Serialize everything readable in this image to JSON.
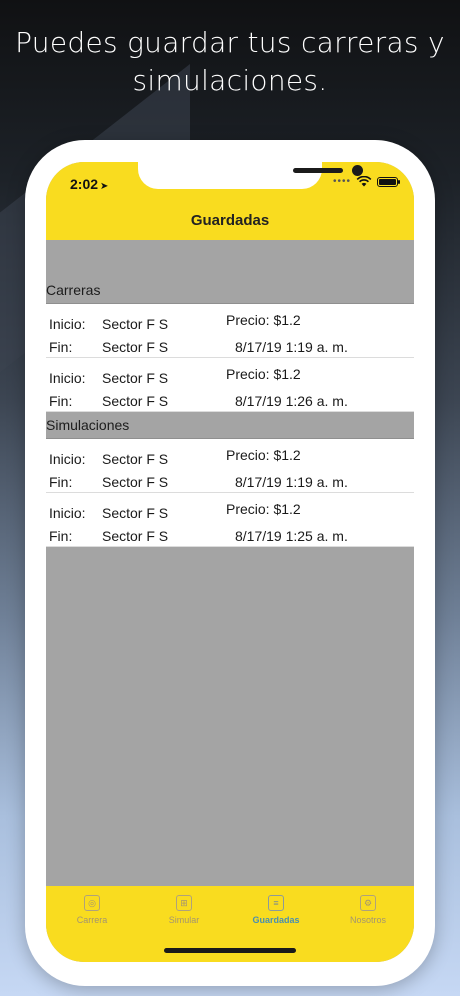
{
  "headline": {
    "line1": "Puedes guardar tus carreras y",
    "line2": "simulaciones."
  },
  "status_bar": {
    "time": "2:02",
    "signal_dots": "••••"
  },
  "nav": {
    "title": "Guardadas"
  },
  "sections": [
    {
      "header": "Carreras",
      "rows": [
        {
          "inicio_label": "Inicio:",
          "inicio_value": "Sector F S",
          "fin_label": "Fin:",
          "fin_value": "Sector F S",
          "precio": "Precio: $1.2",
          "fecha": "8/17/19 1:19 a. m."
        },
        {
          "inicio_label": "Inicio:",
          "inicio_value": "Sector F S",
          "fin_label": "Fin:",
          "fin_value": "Sector F S",
          "precio": "Precio: $1.2",
          "fecha": "8/17/19 1:26 a. m."
        }
      ]
    },
    {
      "header": "Simulaciones",
      "rows": [
        {
          "inicio_label": "Inicio:",
          "inicio_value": "Sector F S",
          "fin_label": "Fin:",
          "fin_value": "Sector F S",
          "precio": "Precio: $1.2",
          "fecha": "8/17/19 1:19 a. m."
        },
        {
          "inicio_label": "Inicio:",
          "inicio_value": "Sector F S",
          "fin_label": "Fin:",
          "fin_value": "Sector F S",
          "precio": "Precio: $1.2",
          "fecha": "8/17/19 1:25 a. m."
        }
      ]
    }
  ],
  "tabs": [
    {
      "label": "Carrera",
      "icon": "meter-icon",
      "glyph": "◎",
      "active": false
    },
    {
      "label": "Simular",
      "icon": "calculator-icon",
      "glyph": "⊞",
      "active": false
    },
    {
      "label": "Guardadas",
      "icon": "document-icon",
      "glyph": "≡",
      "active": true
    },
    {
      "label": "Nosotros",
      "icon": "gear-icon",
      "glyph": "⚙",
      "active": false
    }
  ],
  "colors": {
    "accent_yellow": "#f9dc1f",
    "active_tab": "#4a8fb0",
    "list_background": "#a4a4a4"
  }
}
